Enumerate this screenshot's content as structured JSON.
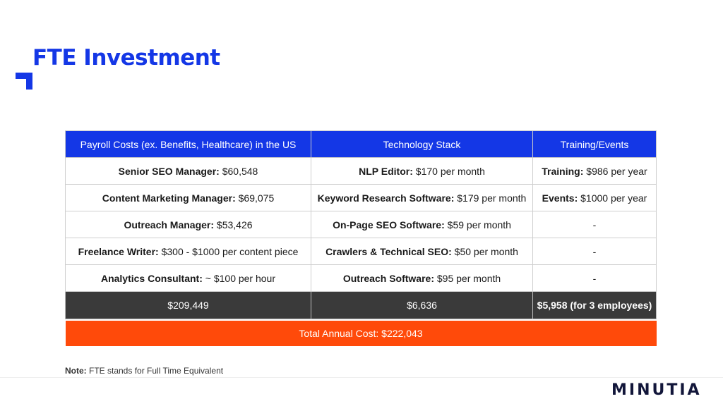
{
  "title": "FTE Investment",
  "table": {
    "headers": [
      "Payroll Costs (ex. Benefits, Healthcare) in the US",
      "Technology Stack",
      "Training/Events"
    ],
    "rows": [
      {
        "c1": {
          "label": "Senior SEO Manager:",
          "value": " $60,548"
        },
        "c2": {
          "label": "NLP Editor:",
          "value": " $170 per month"
        },
        "c3": {
          "label": "Training:",
          "value": " $986 per year"
        }
      },
      {
        "c1": {
          "label": "Content Marketing Manager:",
          "value": " $69,075"
        },
        "c2": {
          "label": "Keyword Research Software:",
          "value": " $179 per month"
        },
        "c3": {
          "label": "Events:",
          "value": " $1000 per year"
        }
      },
      {
        "c1": {
          "label": "Outreach Manager:",
          "value": " $53,426"
        },
        "c2": {
          "label": "On-Page SEO Software:",
          "value": " $59 per month"
        },
        "c3": {
          "label": "",
          "value": "-"
        }
      },
      {
        "c1": {
          "label": "Freelance Writer:",
          "value": " $300 - $1000 per content piece"
        },
        "c2": {
          "label": "Crawlers & Technical SEO:",
          "value": " $50 per month"
        },
        "c3": {
          "label": "",
          "value": "-"
        }
      },
      {
        "c1": {
          "label": "Analytics Consultant:",
          "value": " ~ $100 per hour"
        },
        "c2": {
          "label": "Outreach Software:",
          "value": " $95 per month"
        },
        "c3": {
          "label": "",
          "value": "-"
        }
      }
    ],
    "subtotals": [
      "$209,449",
      "$6,636",
      "$5,958 (for 3 employees)"
    ],
    "total": "Total Annual Cost: $222,043"
  },
  "note": {
    "label": "Note:",
    "text": " FTE stands for Full Time Equivalent"
  },
  "brand": "MINUTIA",
  "colors": {
    "accent": "#1437e6",
    "subtotal_bg": "#3a3a3a",
    "total_bg": "#ff4a0a",
    "brand": "#12163a"
  }
}
